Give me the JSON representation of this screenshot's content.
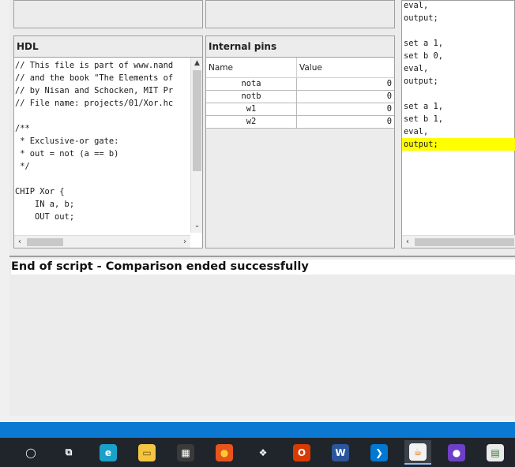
{
  "hdl_panel": {
    "title": "HDL",
    "lines": [
      "// This file is part of www.nand",
      "// and the book \"The Elements of",
      "// by Nisan and Schocken, MIT Pr",
      "// File name: projects/01/Xor.hc",
      "",
      "/**",
      " * Exclusive-or gate:",
      " * out = not (a == b)",
      " */",
      "",
      "CHIP Xor {",
      "    IN a, b;",
      "    OUT out;"
    ]
  },
  "pins_panel": {
    "title": "Internal pins",
    "col_name": "Name",
    "col_value": "Value",
    "rows": [
      {
        "name": "nota",
        "value": "0"
      },
      {
        "name": "notb",
        "value": "0"
      },
      {
        "name": "w1",
        "value": "0"
      },
      {
        "name": "w2",
        "value": "0"
      }
    ]
  },
  "script_panel": {
    "lines": [
      {
        "text": "eval,",
        "highlight": false
      },
      {
        "text": "output;",
        "highlight": false
      },
      {
        "text": "",
        "highlight": false
      },
      {
        "text": "set a 1,",
        "highlight": false
      },
      {
        "text": "set b 0,",
        "highlight": false
      },
      {
        "text": "eval,",
        "highlight": false
      },
      {
        "text": "output;",
        "highlight": false
      },
      {
        "text": "",
        "highlight": false
      },
      {
        "text": "set a 1,",
        "highlight": false
      },
      {
        "text": "set b 1,",
        "highlight": false
      },
      {
        "text": "eval,",
        "highlight": false
      },
      {
        "text": "output;",
        "highlight": true
      }
    ],
    "highlight_color": "#ffff00"
  },
  "status": {
    "message": "End of script - Comparison ended successfully"
  },
  "taskbar": {
    "accent": "#0b78d1",
    "items": [
      {
        "name": "cortana-icon",
        "glyph": "◯",
        "color": "#ffffff",
        "bg": "transparent"
      },
      {
        "name": "task-view-icon",
        "glyph": "⧉",
        "color": "#ffffff",
        "bg": "transparent"
      },
      {
        "name": "edge-icon",
        "glyph": "e",
        "color": "#ffffff",
        "bg": "#1aa1c9"
      },
      {
        "name": "file-explorer-icon",
        "glyph": "▭",
        "color": "#6b4c00",
        "bg": "#f4c542"
      },
      {
        "name": "store-icon",
        "glyph": "▦",
        "color": "#ffffff",
        "bg": "#3a3a3a"
      },
      {
        "name": "firefox-icon",
        "glyph": "●",
        "color": "#ffcc33",
        "bg": "#e8541c"
      },
      {
        "name": "dropbox-icon",
        "glyph": "❖",
        "color": "#ffffff",
        "bg": "transparent"
      },
      {
        "name": "office-icon",
        "glyph": "O",
        "color": "#ffffff",
        "bg": "#d83b01"
      },
      {
        "name": "word-icon",
        "glyph": "W",
        "color": "#ffffff",
        "bg": "#2b579a"
      },
      {
        "name": "vscode-icon",
        "glyph": "❯",
        "color": "#ffffff",
        "bg": "#0078d4"
      },
      {
        "name": "java-icon",
        "glyph": "☕",
        "color": "#e76f00",
        "bg": "#f2f2f2"
      },
      {
        "name": "github-desktop-icon",
        "glyph": "●",
        "color": "#ffffff",
        "bg": "#6e40c9"
      },
      {
        "name": "network-tool-icon",
        "glyph": "▤",
        "color": "#2d7d2d",
        "bg": "#eaeaea"
      }
    ]
  }
}
